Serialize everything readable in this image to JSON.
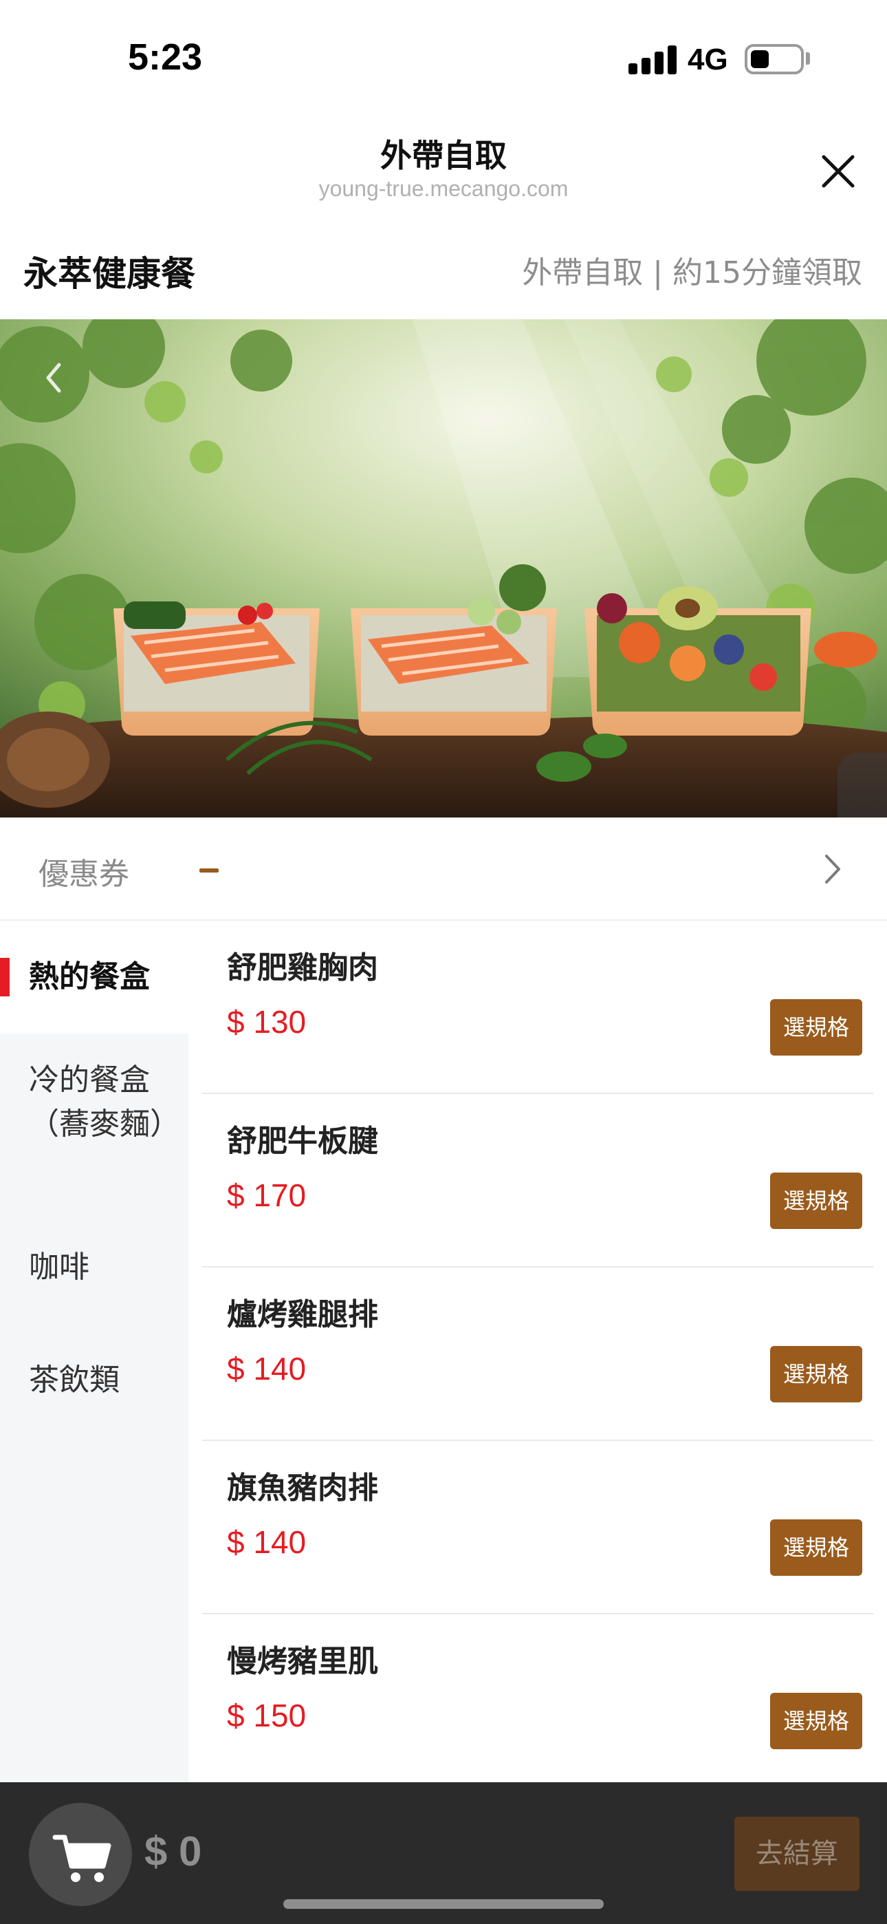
{
  "status_bar": {
    "time": "5:23",
    "network": "4G",
    "icons": [
      "signal-icon",
      "battery-icon"
    ]
  },
  "nav": {
    "title": "外帶自取",
    "url": "young-true.mecango.com",
    "close_icon": "close-icon"
  },
  "store": {
    "name": "永萃健康餐",
    "info": "外帶自取 | 約15分鐘領取"
  },
  "banner": {
    "prev_icon": "chevron-left-icon",
    "side_tab_icon": "chevron-left-icon"
  },
  "coupon": {
    "label": "優惠券",
    "value": "–",
    "chevron_icon": "chevron-right-icon"
  },
  "categories": [
    {
      "label": "熱的餐盒",
      "active": true
    },
    {
      "label": "冷的餐盒（蕎麥麵）",
      "active": false
    },
    {
      "label": "咖啡",
      "active": false
    },
    {
      "label": "茶飲類",
      "active": false
    }
  ],
  "products": [
    {
      "name": "舒肥雞胸肉",
      "price": "$ 130",
      "button": "選規格"
    },
    {
      "name": "舒肥牛板腱",
      "price": "$ 170",
      "button": "選規格"
    },
    {
      "name": "爐烤雞腿排",
      "price": "$ 140",
      "button": "選規格"
    },
    {
      "name": "旗魚豬肉排",
      "price": "$ 140",
      "button": "選規格"
    },
    {
      "name": "慢烤豬里肌",
      "price": "$ 150",
      "button": "選規格"
    }
  ],
  "cart": {
    "icon": "cart-icon",
    "total": "$ 0",
    "checkout_label": "去結算"
  },
  "colors": {
    "accent_brown": "#9a5b1d",
    "price_red": "#e51c23",
    "cart_bar": "#2b2b2b"
  }
}
